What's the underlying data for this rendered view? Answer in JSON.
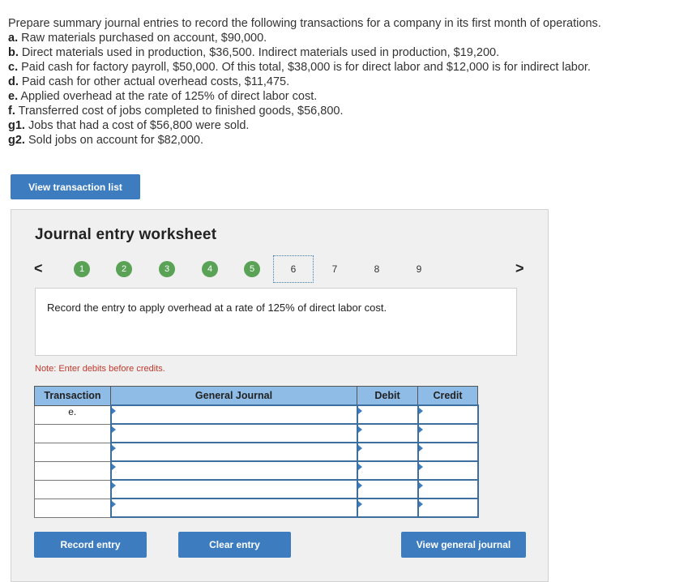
{
  "problem": {
    "intro": "Prepare summary journal entries to record the following transactions for a company in its first month of operations.",
    "items": [
      {
        "label": "a.",
        "text": " Raw materials purchased on account, $90,000."
      },
      {
        "label": "b.",
        "text": " Direct materials used in production, $36,500. Indirect materials used in production, $19,200."
      },
      {
        "label": "c.",
        "text": " Paid cash for factory payroll, $50,000. Of this total, $38,000 is for direct labor and $12,000 is for indirect labor."
      },
      {
        "label": "d.",
        "text": " Paid cash for other actual overhead costs, $11,475."
      },
      {
        "label": "e.",
        "text": " Applied overhead at the rate of 125% of direct labor cost."
      },
      {
        "label": "f.",
        "text": " Transferred cost of jobs completed to finished goods, $56,800."
      },
      {
        "label": "g1.",
        "text": " Jobs that had a cost of $56,800 were sold."
      },
      {
        "label": "g2.",
        "text": " Sold jobs on account for $82,000."
      }
    ]
  },
  "buttons": {
    "view_transaction_list": "View transaction list",
    "record_entry": "Record entry",
    "clear_entry": "Clear entry",
    "view_general_journal": "View general journal"
  },
  "worksheet": {
    "title": "Journal entry worksheet",
    "prev": "<",
    "next": ">",
    "steps": [
      "1",
      "2",
      "3",
      "4",
      "5",
      "6",
      "7",
      "8",
      "9"
    ],
    "instruction": "Record the entry to apply overhead at a rate of 125% of direct labor cost.",
    "note": "Note: Enter debits before credits.",
    "columns": {
      "transaction": "Transaction",
      "general_journal": "General Journal",
      "debit": "Debit",
      "credit": "Credit"
    },
    "rows": [
      {
        "transaction": "e."
      },
      {
        "transaction": ""
      },
      {
        "transaction": ""
      },
      {
        "transaction": ""
      },
      {
        "transaction": ""
      },
      {
        "transaction": ""
      }
    ]
  },
  "colors": {
    "accent": "#3d7dbf",
    "completed_step": "#5aa356",
    "header": "#8fbce6",
    "note": "#c0392b"
  }
}
